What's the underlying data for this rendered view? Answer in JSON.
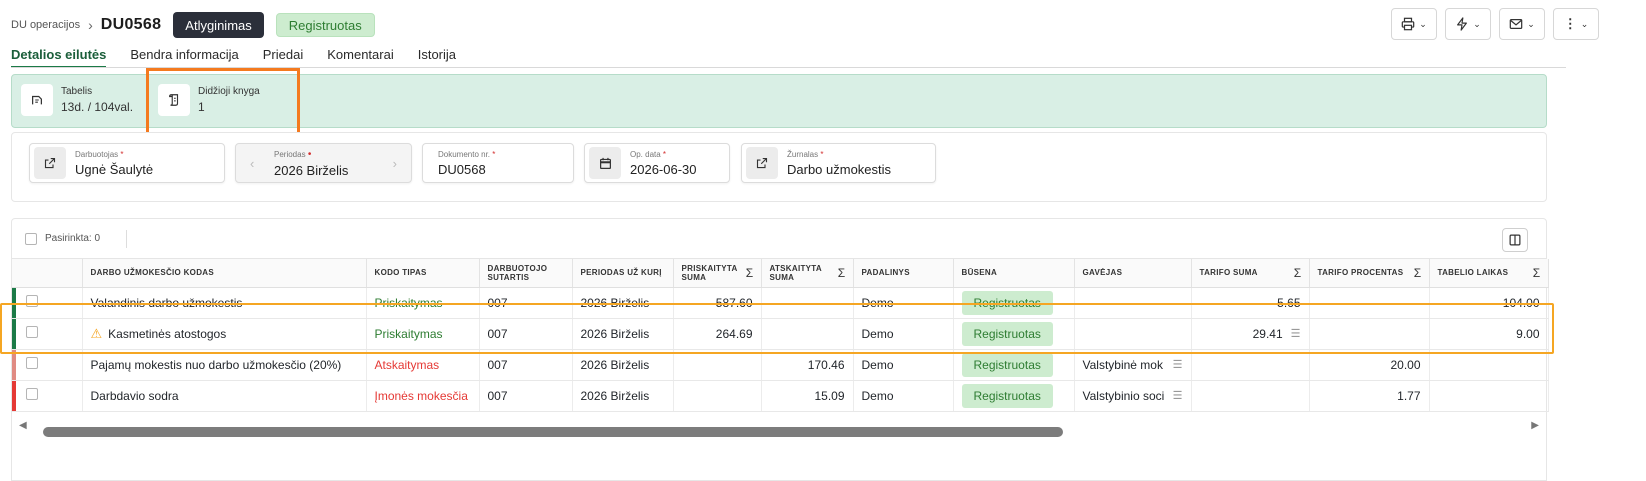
{
  "header": {
    "breadcrumb": "DU operacijos",
    "doc_id": "DU0568",
    "action_button": "Atlyginimas",
    "status_tag": "Registruotas"
  },
  "tabs": [
    "Detalios eilutės",
    "Bendra informacija",
    "Priedai",
    "Komentarai",
    "Istorija"
  ],
  "summary": {
    "tabelis_label": "Tabelis",
    "tabelis_value": "13d. / 104val.",
    "knyga_label": "Didžioji knyga",
    "knyga_value": "1"
  },
  "fields": {
    "employee_label": "Darbuotojas",
    "employee_value": "Ugnė Šaulytė",
    "period_label": "Periodas",
    "period_value": "2026 Birželis",
    "docnr_label": "Dokumento nr.",
    "docnr_value": "DU0568",
    "opdate_label": "Op. data",
    "opdate_value": "2026-06-30",
    "journal_label": "Žurnalas",
    "journal_value": "Darbo užmokestis",
    "required_mark": "*"
  },
  "grid": {
    "selected_label": "Pasirinkta: 0",
    "columns": [
      "Darbo užmokesčio kodas",
      "Kodo tipas",
      "Darbuotojo sutartis",
      "Periodas už kurį",
      "Priskaityta suma",
      "Atskaityta suma",
      "Padalinys",
      "Būsena",
      "Gavėjas",
      "Tarifo suma",
      "Tarifo procentas",
      "Tabelio laikas"
    ],
    "sigma": "Σ",
    "rows": [
      {
        "code": "Valandinis darbo užmokestis",
        "type": "Priskaitymas",
        "contract": "007",
        "period": "2026 Birželis",
        "credit": "587.60",
        "debit": "",
        "unit": "Demo",
        "status": "Registruotas",
        "payee": "",
        "tariff_sum": "5.65",
        "tariff_pct": "",
        "time": "104.00"
      },
      {
        "code": "Kasmetinės atostogos",
        "type": "Priskaitymas",
        "contract": "007",
        "period": "2026 Birželis",
        "credit": "264.69",
        "debit": "",
        "unit": "Demo",
        "status": "Registruotas",
        "payee": "",
        "tariff_sum": "29.41",
        "tariff_pct": "",
        "time": "9.00"
      },
      {
        "code": "Pajamų mokestis nuo darbo užmokesčio (20%)",
        "type": "Atskaitymas",
        "contract": "007",
        "period": "2026 Birželis",
        "credit": "",
        "debit": "170.46",
        "unit": "Demo",
        "status": "Registruotas",
        "payee": "Valstybinė mok",
        "tariff_sum": "",
        "tariff_pct": "20.00",
        "time": ""
      },
      {
        "code": "Darbdavio sodra",
        "type": "Įmonės mokesčia",
        "contract": "007",
        "period": "2026 Birželis",
        "credit": "",
        "debit": "15.09",
        "unit": "Demo",
        "status": "Registruotas",
        "payee": "Valstybinio soci",
        "tariff_sum": "",
        "tariff_pct": "1.77",
        "time": ""
      }
    ]
  },
  "colors": {
    "accent_green": "#1b7a47",
    "earning_bar": "#1b7a47",
    "deduction_bar": "#e08b83",
    "company_tax_bar": "#e53935",
    "highlight_orange": "#f47a1f",
    "highlight_yellow": "#f5a623"
  },
  "icons": [
    "print-icon",
    "lightning-icon",
    "mail-icon",
    "more-vertical-icon",
    "timesheet-icon",
    "ledger-icon",
    "external-link-icon",
    "calendar-icon",
    "warning-icon",
    "columns-icon"
  ]
}
